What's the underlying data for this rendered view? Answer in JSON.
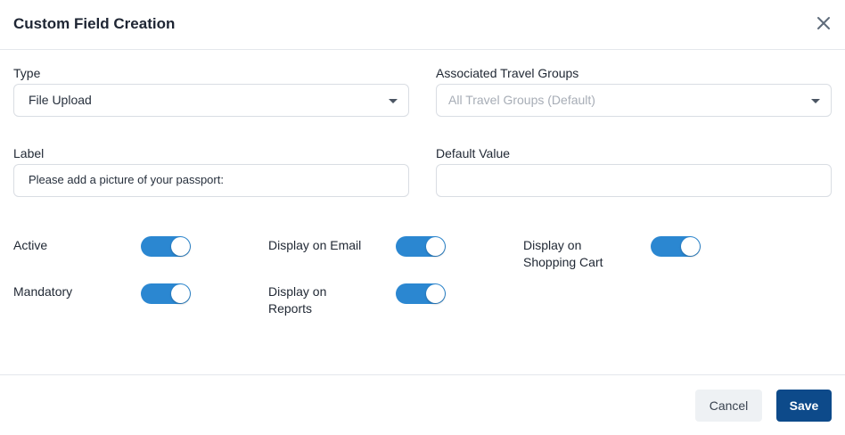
{
  "dialog": {
    "title": "Custom Field Creation",
    "close_icon": "close-icon"
  },
  "form": {
    "type": {
      "label": "Type",
      "value": "File Upload"
    },
    "travel_groups": {
      "label": "Associated Travel Groups",
      "placeholder": "All Travel Groups (Default)"
    },
    "label_field": {
      "label": "Label",
      "value": "Please add a picture of your passport:"
    },
    "default_value": {
      "label": "Default Value",
      "value": ""
    }
  },
  "toggles": {
    "active": {
      "label": "Active",
      "on": true
    },
    "mandatory": {
      "label": "Mandatory",
      "on": true
    },
    "display_email": {
      "label": "Display on Email",
      "on": true
    },
    "display_reports": {
      "label": "Display on Reports",
      "on": true
    },
    "display_cart": {
      "label": "Display on Shopping Cart",
      "on": true
    }
  },
  "footer": {
    "cancel_label": "Cancel",
    "save_label": "Save"
  },
  "colors": {
    "toggle_on": "#2b87d1",
    "save_button": "#0d4a8a",
    "cancel_button": "#eef1f4"
  }
}
